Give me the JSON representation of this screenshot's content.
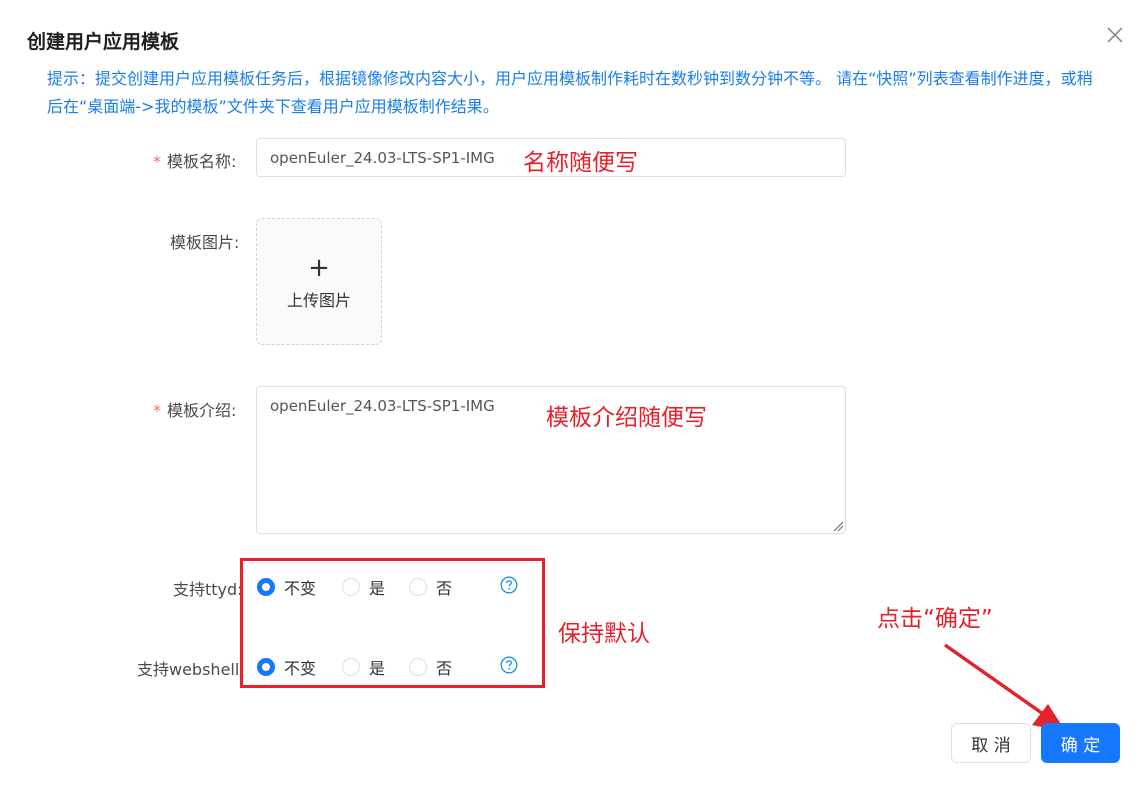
{
  "dialog": {
    "title": "创建用户应用模板",
    "tip": "提示：提交创建用户应用模板任务后，根据镜像修改内容大小，用户应用模板制作耗时在数秒钟到数分钟不等。 请在“快照”列表查看制作进度，或稍后在“桌面端->我的模板”文件夹下查看用户应用模板制作结果。"
  },
  "form": {
    "required_mark": "*",
    "name": {
      "label": "模板名称:",
      "value": "openEuler_24.03-LTS-SP1-IMG"
    },
    "image": {
      "label": "模板图片:",
      "plus": "+",
      "upload_text": "上传图片"
    },
    "intro": {
      "label": "模板介绍:",
      "value": "openEuler_24.03-LTS-SP1-IMG"
    },
    "ttyd": {
      "label": "支持ttyd:",
      "options": [
        "不变",
        "是",
        "否"
      ],
      "selected": "不变"
    },
    "webshell": {
      "label": "支持webshell:",
      "options": [
        "不变",
        "是",
        "否"
      ],
      "selected": "不变"
    }
  },
  "annotations": {
    "name_hint": "名称随便写",
    "intro_hint": "模板介绍随便写",
    "keep_default": "保持默认",
    "click_ok": "点击“确定”"
  },
  "footer": {
    "cancel_label": "取 消",
    "ok_label": "确 定"
  },
  "colors": {
    "primary": "#1677ff",
    "annotation": "#e5222b",
    "tip": "#1a7ee6",
    "required": "#f56c6c"
  }
}
